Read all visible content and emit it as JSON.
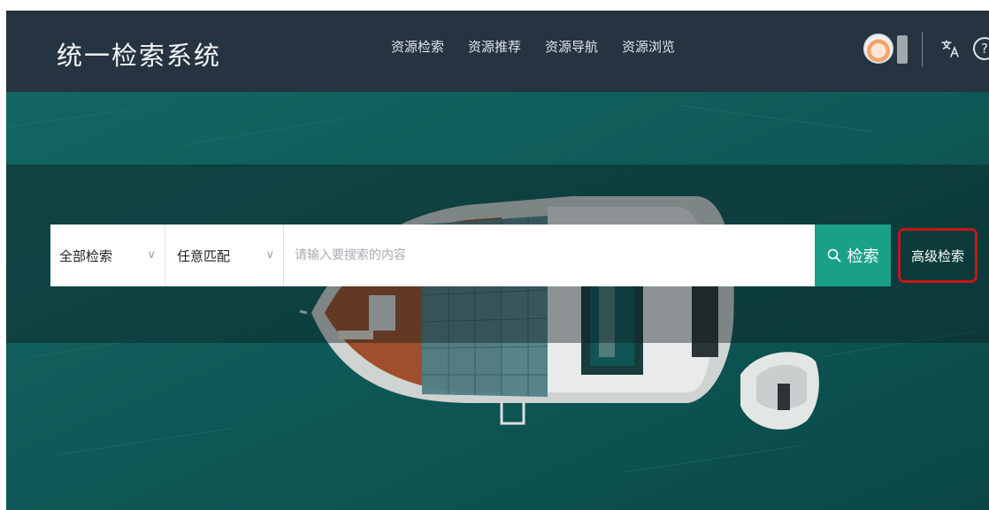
{
  "header": {
    "title": "统一检索系统",
    "nav": [
      {
        "label": "资源检索"
      },
      {
        "label": "资源推荐"
      },
      {
        "label": "资源导航"
      },
      {
        "label": "资源浏览"
      }
    ],
    "help_label": "?"
  },
  "search": {
    "scope_label": "全部检索",
    "match_label": "任意匹配",
    "chevron": "∨",
    "placeholder": "请输入要搜索的内容",
    "button_label": "检索",
    "advanced_label": "高级检索"
  },
  "colors": {
    "header_bg": "#263340",
    "search_button": "#1aa088",
    "highlight_border": "#c4161c"
  }
}
